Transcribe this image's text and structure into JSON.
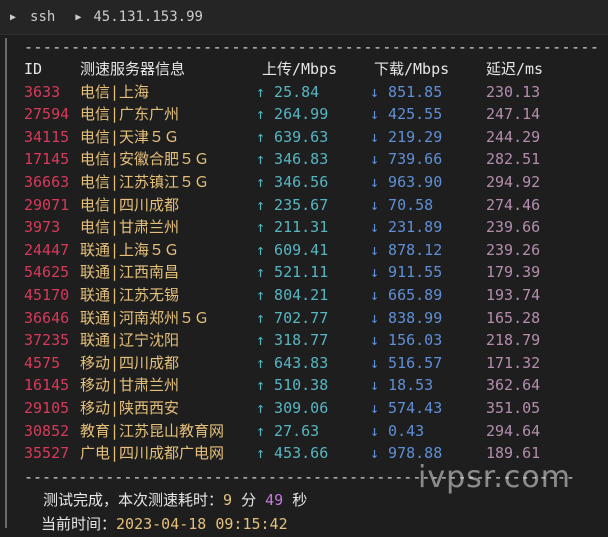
{
  "tab": {
    "shell": "ssh",
    "host": "45.131.153.99"
  },
  "rule": "-------------------------------------------------------------",
  "header": {
    "id": "ID",
    "name": "测速服务器信息",
    "up": "上传/Mbps",
    "down": "下载/Mbps",
    "latency": "延迟/ms"
  },
  "rows": [
    {
      "id": "3633",
      "name": "电信|上海",
      "up": "↑ 25.84",
      "down": "↓ 851.85",
      "latency": "230.13"
    },
    {
      "id": "27594",
      "name": "电信|广东广州",
      "up": "↑ 264.99",
      "down": "↓ 425.55",
      "latency": "247.14"
    },
    {
      "id": "34115",
      "name": "电信|天津５Ｇ",
      "up": "↑ 639.63",
      "down": "↓ 219.29",
      "latency": "244.29"
    },
    {
      "id": "17145",
      "name": "电信|安徽合肥５Ｇ",
      "up": "↑ 346.83",
      "down": "↓ 739.66",
      "latency": "282.51"
    },
    {
      "id": "36663",
      "name": "电信|江苏镇江５Ｇ",
      "up": "↑ 346.56",
      "down": "↓ 963.90",
      "latency": "294.92"
    },
    {
      "id": "29071",
      "name": "电信|四川成都",
      "up": "↑ 235.67",
      "down": "↓ 70.58",
      "latency": "274.46"
    },
    {
      "id": "3973",
      "name": "电信|甘肃兰州",
      "up": "↑ 211.31",
      "down": "↓ 231.89",
      "latency": "239.66"
    },
    {
      "id": "24447",
      "name": "联通|上海５Ｇ",
      "up": "↑ 609.41",
      "down": "↓ 878.12",
      "latency": "239.26"
    },
    {
      "id": "54625",
      "name": "联通|江西南昌",
      "up": "↑ 521.11",
      "down": "↓ 911.55",
      "latency": "179.39"
    },
    {
      "id": "45170",
      "name": "联通|江苏无锡",
      "up": "↑ 804.21",
      "down": "↓ 665.89",
      "latency": "193.74"
    },
    {
      "id": "36646",
      "name": "联通|河南郑州５Ｇ",
      "up": "↑ 702.77",
      "down": "↓ 838.99",
      "latency": "165.28"
    },
    {
      "id": "37235",
      "name": "联通|辽宁沈阳",
      "up": "↑ 318.77",
      "down": "↓ 156.03",
      "latency": "218.79"
    },
    {
      "id": "4575",
      "name": "移动|四川成都",
      "up": "↑ 643.83",
      "down": "↓ 516.57",
      "latency": "171.32"
    },
    {
      "id": "16145",
      "name": "移动|甘肃兰州",
      "up": "↑ 510.38",
      "down": "↓ 18.53",
      "latency": "362.64"
    },
    {
      "id": "29105",
      "name": "移动|陕西西安",
      "up": "↑ 309.06",
      "down": "↓ 574.43",
      "latency": "351.05"
    },
    {
      "id": "30852",
      "name": "教育|江苏昆山教育网",
      "up": "↑ 27.63",
      "down": "↓ 0.43",
      "latency": "294.64"
    },
    {
      "id": "35527",
      "name": "广电|四川成都广电网",
      "up": "↑ 453.66",
      "down": "↓ 978.88",
      "latency": "189.61"
    }
  ],
  "footer": {
    "done_prefix": "测试完成，本次测速耗时：",
    "minutes": "9",
    "min_unit": "分",
    "seconds": "49",
    "sec_unit": "秒",
    "time_label": "当前时间：",
    "time_value": "2023-04-18 09:15:42"
  },
  "watermark": "ivpsr.com",
  "colors": {
    "id": "#d73a5a",
    "name": "#e5c07b",
    "up": "#56b6c2",
    "down": "#5f8fd6",
    "latency": "#b48ead"
  }
}
